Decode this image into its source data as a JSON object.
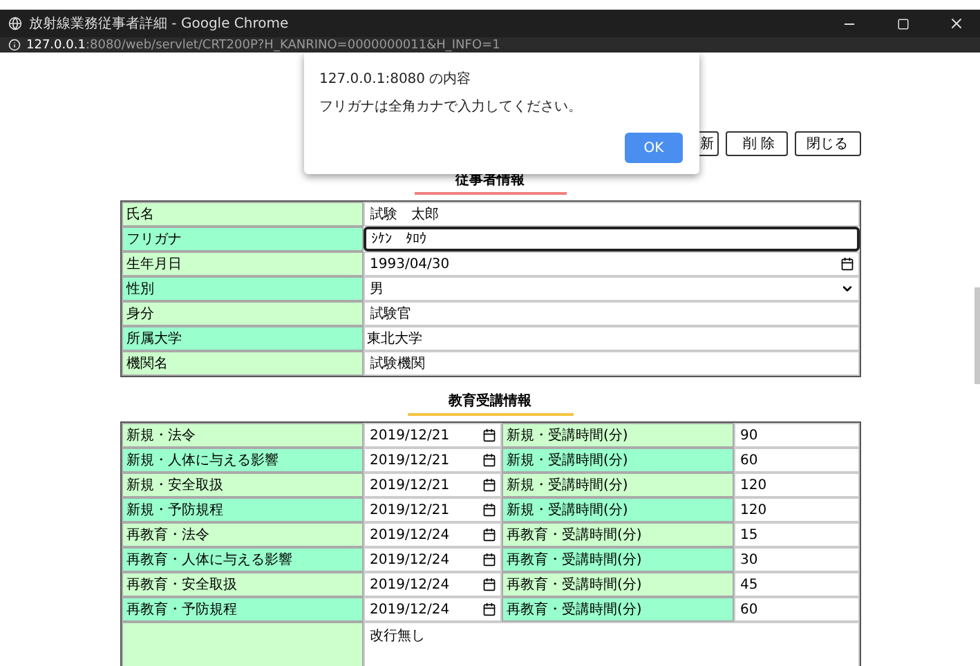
{
  "window": {
    "title": "放射線業務従事者詳細 - Google Chrome",
    "url_host": "127.0.0.1",
    "url_rest": ":8080/web/servlet/CRT200P?H_KANRINO=0000000011&H_INFO=1"
  },
  "buttons": [
    {
      "label": "新"
    },
    {
      "label": "削 除"
    },
    {
      "label": "閉じる"
    }
  ],
  "dialog": {
    "title": "127.0.0.1:8080 の内容",
    "message": "フリガナは全角カナで入力してください。",
    "button": "OK"
  },
  "staff_info": {
    "title": "従事者情報",
    "rows": [
      {
        "label": "氏名",
        "kind": "text",
        "value": "試験　太郎",
        "focused": false
      },
      {
        "label": "フリガナ",
        "kind": "text",
        "value": "ｼｹﾝ　ﾀﾛｳ",
        "focused": true
      },
      {
        "label": "生年月日",
        "kind": "date",
        "value": "1993/04/30"
      },
      {
        "label": "性別",
        "kind": "select",
        "value": "男"
      },
      {
        "label": "身分",
        "kind": "text",
        "value": "試験官",
        "focused": false
      },
      {
        "label": "所属大学",
        "kind": "plain",
        "value": "東北大学"
      },
      {
        "label": "機関名",
        "kind": "text",
        "value": "試験機関",
        "focused": false
      }
    ]
  },
  "training": {
    "title": "教育受講情報",
    "rows": [
      {
        "label": "新規・法令",
        "date": "2019/12/21",
        "duration_label": "新規・受講時間(分)",
        "minutes": "90"
      },
      {
        "label": "新規・人体に与える影響",
        "date": "2019/12/21",
        "duration_label": "新規・受講時間(分)",
        "minutes": "60"
      },
      {
        "label": "新規・安全取扱",
        "date": "2019/12/21",
        "duration_label": "新規・受講時間(分)",
        "minutes": "120"
      },
      {
        "label": "新規・予防規程",
        "date": "2019/12/21",
        "duration_label": "新規・受講時間(分)",
        "minutes": "120"
      },
      {
        "label": "再教育・法令",
        "date": "2019/12/24",
        "duration_label": "再教育・受講時間(分)",
        "minutes": "15"
      },
      {
        "label": "再教育・人体に与える影響",
        "date": "2019/12/24",
        "duration_label": "再教育・受講時間(分)",
        "minutes": "30"
      },
      {
        "label": "再教育・安全取扱",
        "date": "2019/12/24",
        "duration_label": "再教育・受講時間(分)",
        "minutes": "45"
      },
      {
        "label": "再教育・予防規程",
        "date": "2019/12/24",
        "duration_label": "再教育・受講時間(分)",
        "minutes": "60"
      }
    ],
    "remarks": {
      "value": "改行無し"
    }
  }
}
